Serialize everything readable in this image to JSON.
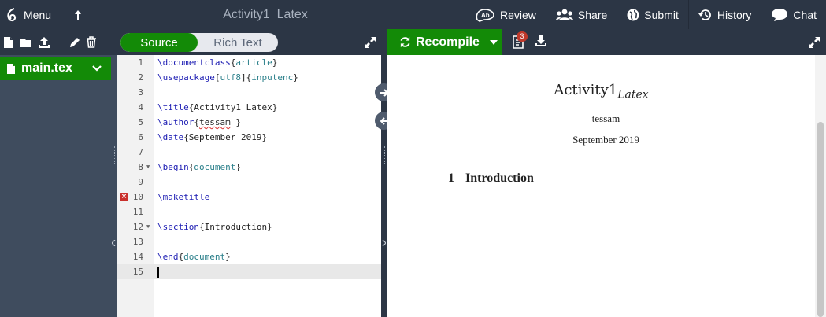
{
  "topbar": {
    "menu_label": "Menu",
    "project_title": "Activity1_Latex",
    "buttons": [
      {
        "label": "Review",
        "icon": "review-icon"
      },
      {
        "label": "Share",
        "icon": "share-icon"
      },
      {
        "label": "Submit",
        "icon": "globe-icon"
      },
      {
        "label": "History",
        "icon": "history-icon"
      },
      {
        "label": "Chat",
        "icon": "chat-icon"
      }
    ]
  },
  "editor_toggle": {
    "source": "Source",
    "rich_text": "Rich Text",
    "active": "Source"
  },
  "recompile": {
    "label": "Recompile",
    "logs_count": "3"
  },
  "file_tree": {
    "items": [
      {
        "name": "main.tex",
        "selected": true
      }
    ]
  },
  "editor": {
    "lines": [
      {
        "n": "1",
        "cmd": "\\documentclass",
        "rest": "{article}",
        "args": [
          "article"
        ]
      },
      {
        "n": "2",
        "cmd": "\\usepackage",
        "rest": "[utf8]{inputenc}",
        "args": [
          "utf8",
          "inputenc"
        ]
      },
      {
        "n": "3",
        "cmd": "",
        "rest": ""
      },
      {
        "n": "4",
        "cmd": "\\title",
        "rest": "{Activity1_Latex}"
      },
      {
        "n": "5",
        "cmd": "\\author",
        "rest": "{tessam }"
      },
      {
        "n": "6",
        "cmd": "\\date",
        "rest": "{September 2019}"
      },
      {
        "n": "7",
        "cmd": "",
        "rest": ""
      },
      {
        "n": "8",
        "cmd": "\\begin",
        "rest": "{document}",
        "args": [
          "document"
        ],
        "fold": true
      },
      {
        "n": "9",
        "cmd": "",
        "rest": ""
      },
      {
        "n": "10",
        "cmd": "\\maketitle",
        "rest": "",
        "error": true
      },
      {
        "n": "11",
        "cmd": "",
        "rest": ""
      },
      {
        "n": "12",
        "cmd": "\\section",
        "rest": "{Introduction}",
        "fold": true
      },
      {
        "n": "13",
        "cmd": "",
        "rest": ""
      },
      {
        "n": "14",
        "cmd": "\\end",
        "rest": "{document}",
        "args": [
          "document"
        ]
      },
      {
        "n": "15",
        "cmd": "",
        "rest": "",
        "active": true
      }
    ]
  },
  "preview": {
    "title_main": "Activity1",
    "title_sub": "Latex",
    "author": "tessam",
    "date": "September 2019",
    "section_number": "1",
    "section_title": "Introduction"
  },
  "colors": {
    "accent": "#138a07",
    "topbar": "#2c3645",
    "sidebar": "#3f4c5e",
    "error": "#c9302c"
  }
}
